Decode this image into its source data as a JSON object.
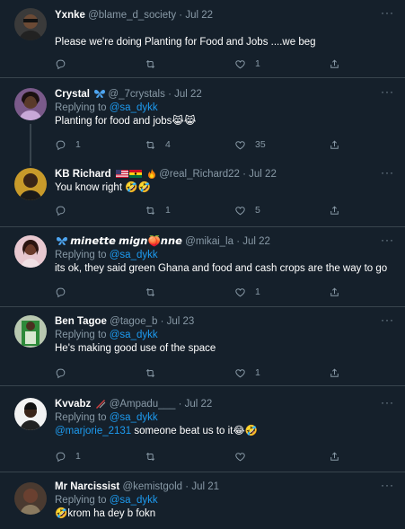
{
  "reply_prefix": "Replying to",
  "more_glyph": "···",
  "colors": {
    "background": "#15202b",
    "text": "#ffffff",
    "muted": "#8899a6",
    "link": "#1d9bf0",
    "divider": "#38444d"
  },
  "tweets": [
    {
      "name": "Yxnke",
      "handle": "@blame_d_society",
      "date": "Jul 22",
      "reply_to": "",
      "text_mention": "",
      "text": "Please we're doing Planting for Food and Jobs ....we beg",
      "counts": {
        "reply": "",
        "retweet": "",
        "like": "1"
      }
    },
    {
      "name": "Crystal",
      "handle": "@_7crystals",
      "date": "Jul 22",
      "reply_to": "@sa_dykk",
      "text_mention": "",
      "text": "Planting for food and jobs😹😹",
      "counts": {
        "reply": "1",
        "retweet": "4",
        "like": "35"
      }
    },
    {
      "name": "KB Richard",
      "handle": "@real_Richard22",
      "date": "Jul 22",
      "reply_to": "",
      "text_mention": "",
      "text": "You know right 🤣🤣",
      "counts": {
        "reply": "",
        "retweet": "1",
        "like": "5"
      }
    },
    {
      "name": "𝙢𝙞𝙣𝙚𝙩𝙩𝙚 𝙢𝙞𝙜𝙣🍑𝙣𝙣𝙚",
      "handle": "@mikai_la",
      "date": "Jul 22",
      "reply_to": "@sa_dykk",
      "text_mention": "",
      "text": "its ok, they said green Ghana and food and cash crops are the way to go",
      "counts": {
        "reply": "",
        "retweet": "",
        "like": "1"
      }
    },
    {
      "name": "Ben Tagoe",
      "handle": "@tagoe_b",
      "date": "Jul 23",
      "reply_to": "@sa_dykk",
      "text_mention": "",
      "text": "He's making good use of the space",
      "counts": {
        "reply": "",
        "retweet": "",
        "like": "1"
      }
    },
    {
      "name": "Kvvabz",
      "handle": "@Ampadu___",
      "date": "Jul 22",
      "reply_to": "@sa_dykk",
      "text_mention": "@marjorie_2131",
      "text": " someone beat us to it😂🤣",
      "counts": {
        "reply": "1",
        "retweet": "",
        "like": ""
      }
    },
    {
      "name": "Mr Narcissist",
      "handle": "@kemistgold",
      "date": "Jul 21",
      "reply_to": "@sa_dykk",
      "text_mention": "",
      "text": "🤣krom ha dey b fokn",
      "counts": {
        "reply": "",
        "retweet": "",
        "like": ""
      }
    }
  ]
}
